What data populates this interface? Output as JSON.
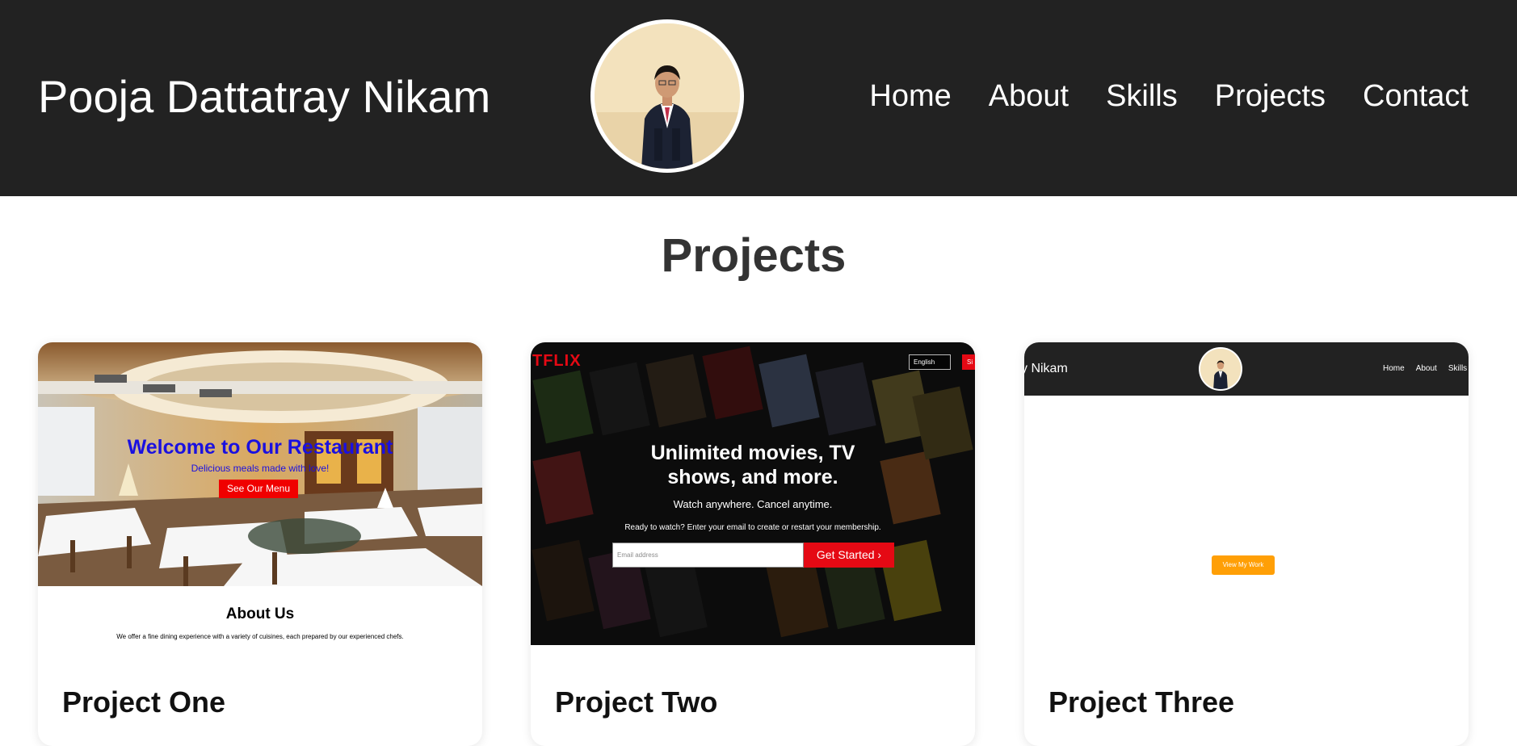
{
  "header": {
    "site_title": "Pooja Dattatray Nikam",
    "nav": [
      "Home",
      "About",
      "Skills",
      "Projects",
      "Contact"
    ]
  },
  "projects_section": {
    "title": "Projects",
    "cards": [
      {
        "title": "Project One",
        "preview": {
          "heading": "Welcome to Our Restaurant",
          "subheading": "Delicious meals made with love!",
          "button": "See Our Menu",
          "about_title": "About Us",
          "about_text": "We offer a fine dining experience with a variety of cuisines, each prepared by our experienced chefs."
        }
      },
      {
        "title": "Project Two",
        "preview": {
          "logo": "TFLIX",
          "language": "English",
          "signin": "Si",
          "headline_line1": "Unlimited movies, TV",
          "headline_line2": "shows, and more.",
          "watch": "Watch anywhere. Cancel anytime.",
          "ready": "Ready to watch? Enter your email to create or restart your membership.",
          "email_placeholder": "Email address",
          "cta": "Get Started"
        }
      },
      {
        "title": "Project Three",
        "preview": {
          "name": "y Nikam",
          "nav": [
            "Home",
            "About",
            "Skills"
          ],
          "button": "View My Work"
        }
      }
    ]
  },
  "colors": {
    "header_bg": "#222222",
    "card_two_red": "#e50914",
    "restaurant_blue": "#1a10e0",
    "view_work_orange": "#ff9f06"
  }
}
